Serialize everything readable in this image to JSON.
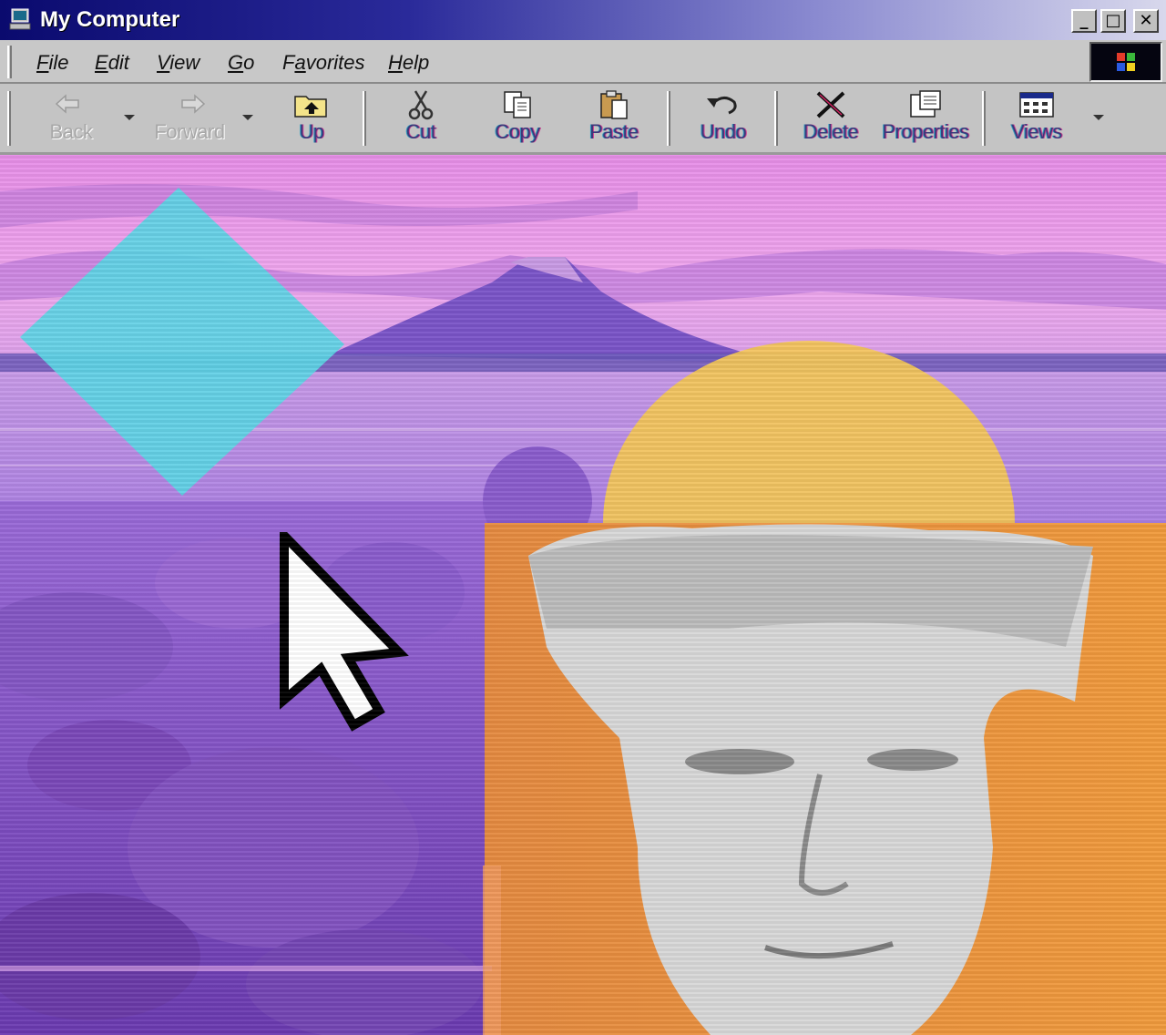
{
  "window": {
    "title": "My Computer"
  },
  "title_buttons": {
    "minimize": "_",
    "maximize": "□",
    "close": "✕"
  },
  "menu": {
    "items": [
      {
        "label": "File",
        "underline": "F",
        "rest": "ile"
      },
      {
        "label": "Edit",
        "underline": "E",
        "rest": "dit"
      },
      {
        "label": "View",
        "underline": "V",
        "rest": "iew"
      },
      {
        "label": "Go",
        "underline": "G",
        "rest": "o"
      },
      {
        "label": "Favorites",
        "underline": "a",
        "pre": "F",
        "rest": "vorites"
      },
      {
        "label": "Help",
        "underline": "H",
        "rest": "elp"
      }
    ]
  },
  "toolbar": {
    "back": "Back",
    "forward": "Forward",
    "up": "Up",
    "cut": "Cut",
    "copy": "Copy",
    "paste": "Paste",
    "undo": "Undo",
    "delete": "Delete",
    "properties": "Properties",
    "views": "Views"
  },
  "icons": {
    "computer": "computer-icon",
    "throbber": "windows-logo-icon",
    "back": "back-arrow-icon",
    "forward": "forward-arrow-icon",
    "up": "up-folder-icon",
    "cut": "scissors-icon",
    "copy": "copy-icon",
    "paste": "paste-icon",
    "undo": "undo-icon",
    "delete": "delete-x-icon",
    "properties": "properties-icon",
    "views": "views-icon",
    "cursor": "mouse-pointer-icon"
  },
  "colors": {
    "sky": "#e49ae8",
    "sea": "#b88ae0",
    "diamond": "#5cd6e6",
    "sun": "#f3c65a",
    "orange_panel": "#e98a3c",
    "title_bar": "#0a0a6e"
  }
}
